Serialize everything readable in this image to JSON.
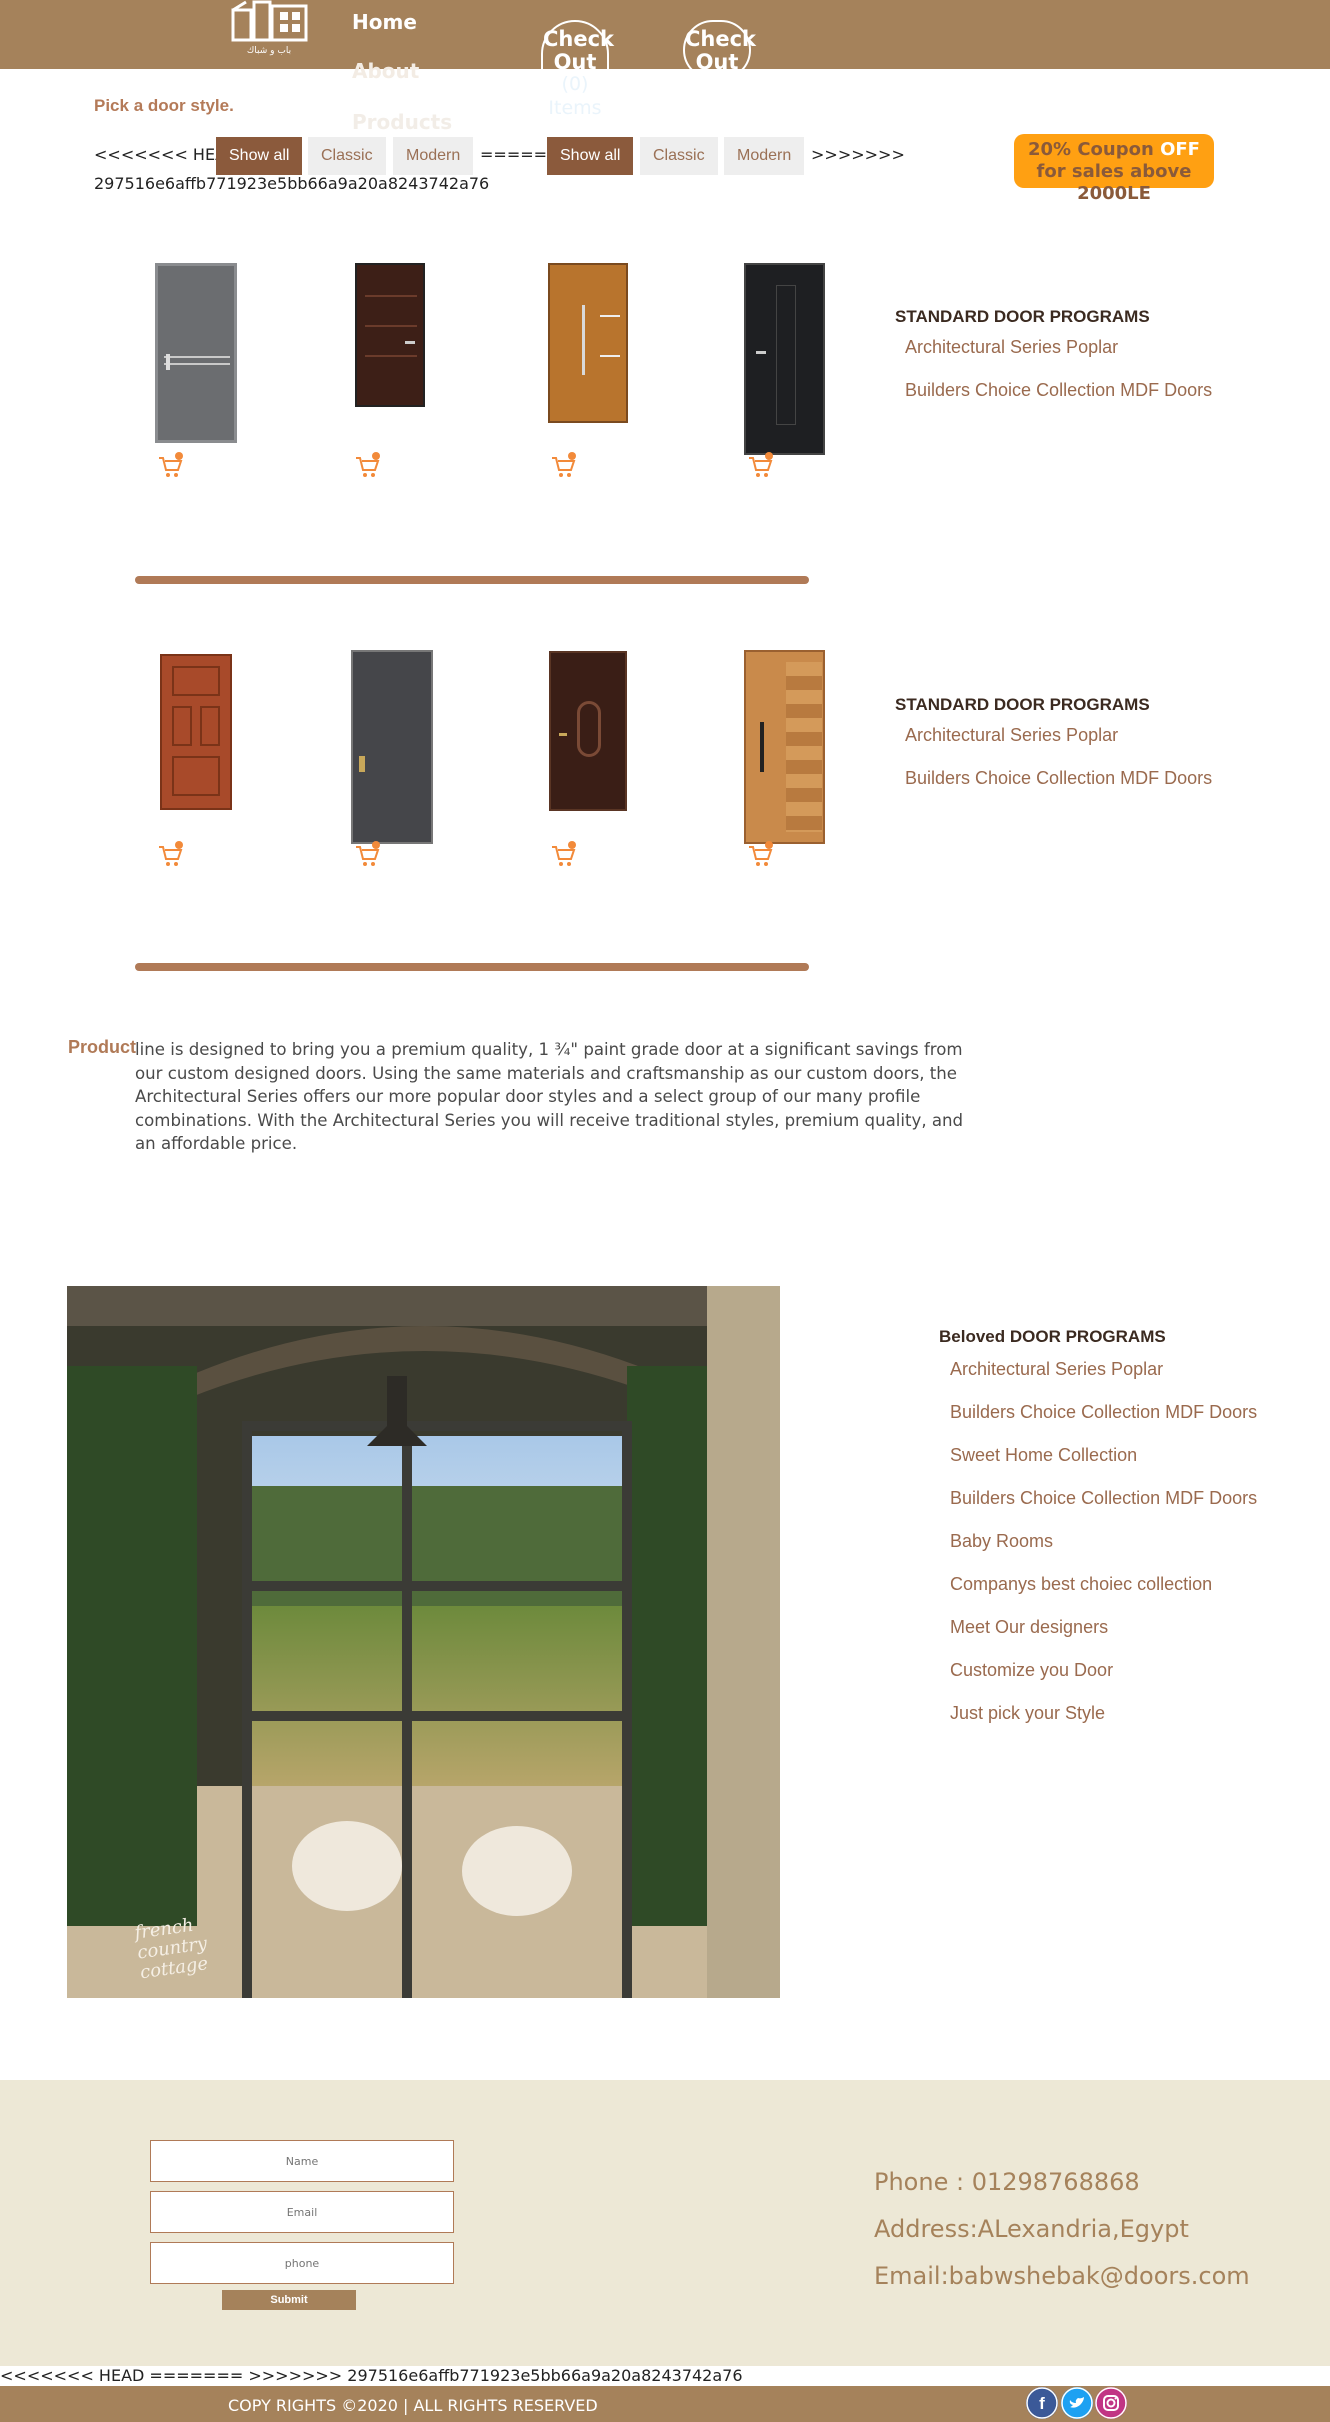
{
  "header": {
    "logo_text": "باب و شباك",
    "nav": {
      "home": "Home",
      "about": "About",
      "products": "Products"
    },
    "checkout_label_1": "Check Out",
    "checkout_label_2": "Check Out",
    "cart_count": "(0) Items",
    "brand_color": "#a5825b"
  },
  "filters": {
    "title": "Pick a door style.",
    "head_marker": "<<<<<<< HEAD",
    "separator": "=======",
    "end_marker": ">>>>>>>",
    "buttons_head": [
      "Show all",
      "Classic",
      "Modern"
    ],
    "buttons_other": [
      "Show all",
      "Classic",
      "Modern"
    ],
    "commit_hash": "297516e6affb771923e5bb66a9a20a8243742a76"
  },
  "coupon": {
    "part1": "20% Coupon ",
    "highlight": "OFF",
    "part2": " for sales above 2000LE",
    "color": "#ffa012"
  },
  "programs_1": {
    "title": "STANDARD DOOR PROGRAMS",
    "links": [
      "Architectural Series Poplar",
      "Builders Choice Collection MDF Doors"
    ]
  },
  "programs_2": {
    "title": "STANDARD DOOR PROGRAMS",
    "links": [
      "Architectural Series Poplar",
      "Builders Choice Collection MDF Doors"
    ]
  },
  "product": {
    "label": "Product",
    "description": "line is designed to bring you a premium quality, 1 ¾\" paint grade door at a significant savings from our custom designed doors. Using the same materials and craftsmanship as our custom doors, the Architectural Series offers our more popular door styles and a select group of our many profile combinations. With the Architectural Series you will receive traditional styles, premium quality, and an affordable price."
  },
  "garden_caption": "french country cottage",
  "beloved": {
    "title": "Beloved DOOR PROGRAMS",
    "links": [
      "Architectural Series Poplar",
      "Builders Choice Collection MDF Doors",
      "Sweet Home Collection",
      "Builders Choice Collection MDF Doors",
      "Baby Rooms",
      "Companys best choiec collection",
      "Meet Our designers",
      "Customize you Door",
      "Just pick your Style"
    ]
  },
  "form": {
    "name_placeholder": "Name",
    "email_placeholder": "Email",
    "phone_placeholder": "phone",
    "submit": "Submit"
  },
  "contact": {
    "phone": "Phone : 01298768868",
    "address": "Address:ALexandria,Egypt",
    "email": "Email:babwshebak@doors.com"
  },
  "bottom_merge_line": "<<<<<<< HEAD ======= >>>>>>> 297516e6affb771923e5bb66a9a20a8243742a76",
  "copyright": "COPY RIGHTS ©2020 | ALL RIGHTS RESERVED",
  "social": [
    "facebook-icon",
    "twitter-icon",
    "instagram-icon"
  ]
}
